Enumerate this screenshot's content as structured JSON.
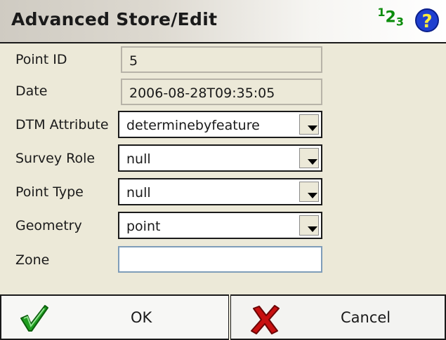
{
  "window": {
    "title": "Advanced Store/Edit",
    "indicator": {
      "base": "1",
      "sub": "3",
      "mid": "2"
    },
    "help_label": "?"
  },
  "form": {
    "point_id_label": "Point ID",
    "point_id_value": "5",
    "date_label": "Date",
    "date_value": "2006-08-28T09:35:05",
    "dtm_label": "DTM Attribute",
    "dtm_value": "determinebyfeature",
    "survey_role_label": "Survey Role",
    "survey_role_value": "null",
    "point_type_label": "Point Type",
    "point_type_value": "null",
    "geometry_label": "Geometry",
    "geometry_value": "point",
    "zone_label": "Zone",
    "zone_value": ""
  },
  "buttons": {
    "ok_label": "OK",
    "cancel_label": "Cancel"
  },
  "colors": {
    "check_green": "#1f9e1f",
    "cancel_red": "#c81010",
    "help_blue": "#1f3fd0",
    "indicator_green": "#0b8c0b"
  }
}
